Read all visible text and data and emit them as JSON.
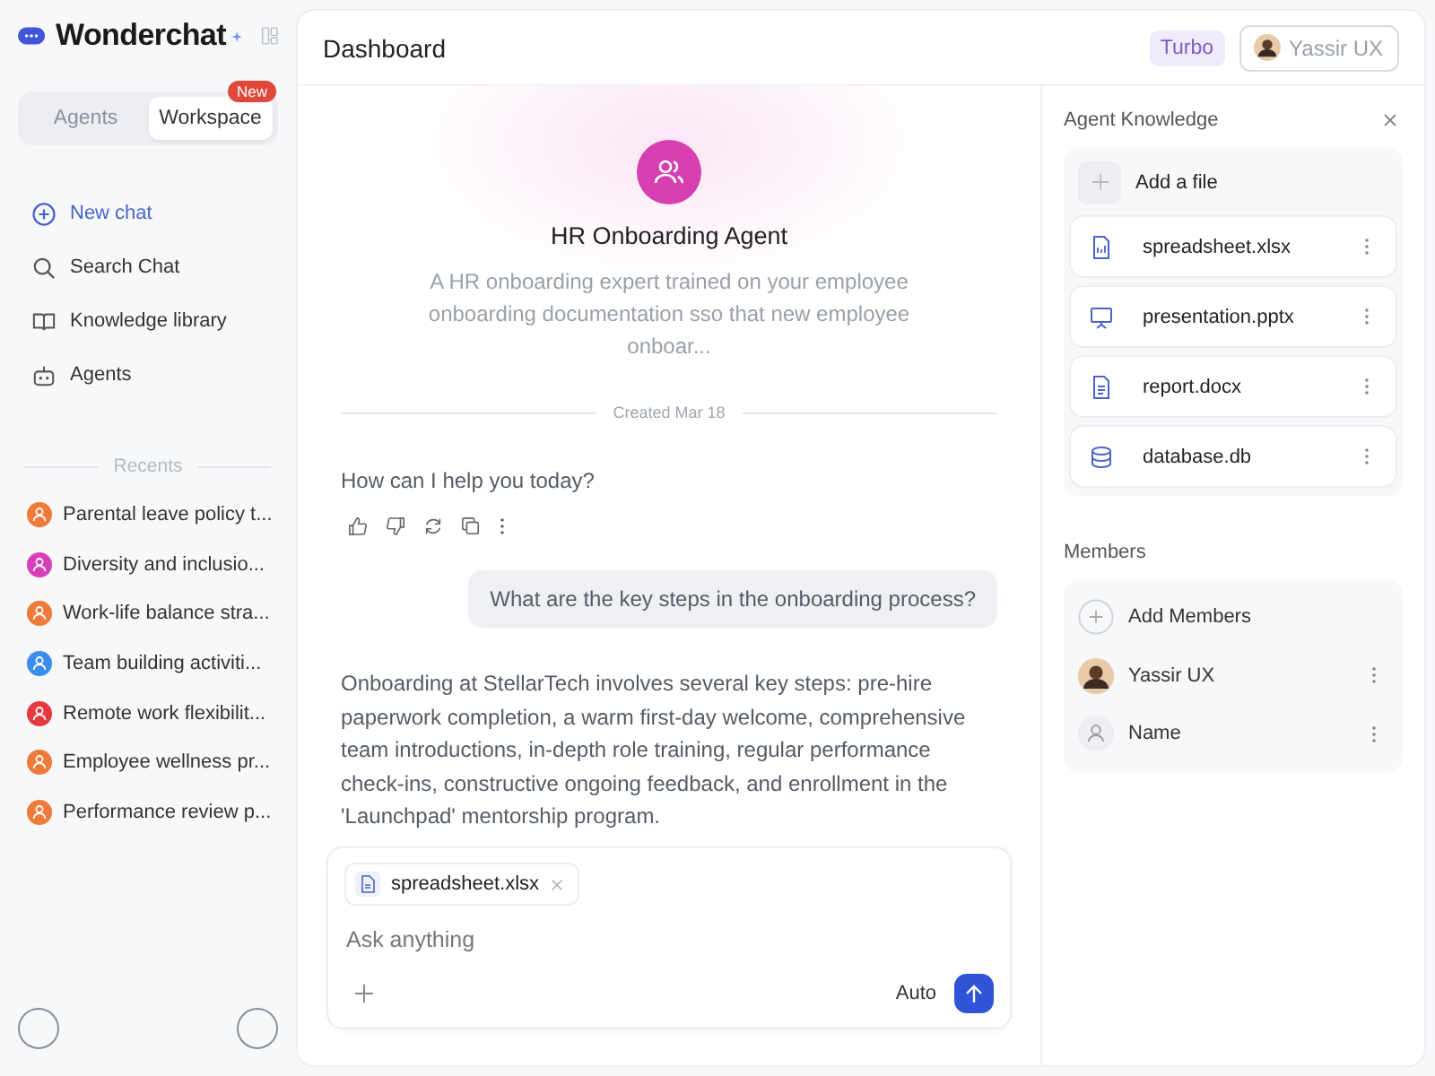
{
  "app": {
    "name": "Wonderchat"
  },
  "sidebar_tabs": [
    {
      "label": "Agents",
      "selected": false
    },
    {
      "label": "Workspace",
      "selected": true,
      "badge": "New"
    }
  ],
  "nav": [
    {
      "kind": "new",
      "label": "New chat"
    },
    {
      "kind": "search",
      "label": "Search Chat"
    },
    {
      "kind": "library",
      "label": "Knowledge library"
    },
    {
      "kind": "agents",
      "label": "Agents"
    }
  ],
  "recents_label": "Recents",
  "recents": [
    {
      "title": "Parental leave policy t...",
      "color": "#f07a3a"
    },
    {
      "title": "Diversity and inclusio...",
      "color": "#d63fb8"
    },
    {
      "title": "Work-life balance stra...",
      "color": "#f07a3a"
    },
    {
      "title": "Team building activiti...",
      "color": "#3b8ef0"
    },
    {
      "title": "Remote work flexibilit...",
      "color": "#e5393f"
    },
    {
      "title": "Employee wellness pr...",
      "color": "#f07a3a"
    },
    {
      "title": "Performance review p...",
      "color": "#f07a3a"
    }
  ],
  "header": {
    "title": "Dashboard",
    "plan": "Turbo",
    "user": "Yassir UX"
  },
  "agent": {
    "name": "HR Onboarding Agent",
    "description": "A HR onboarding expert trained on your employee onboarding documentation sso that new employee onboar...",
    "created": "Created Mar 18"
  },
  "messages": [
    {
      "kind": "assistant",
      "text": "How can I help you today?",
      "actions": true
    },
    {
      "kind": "user",
      "text": "What are the key steps in the onboarding process?",
      "actions": false
    },
    {
      "kind": "assistant",
      "text": "Onboarding at StellarTech involves several key steps: pre-hire paperwork completion, a warm first-day welcome, comprehensive team introductions, in-depth role training, regular performance check-ins, constructive ongoing feedback, and enrollment in the 'Launchpad' mentorship program.",
      "actions": false
    }
  ],
  "composer": {
    "attachments": [
      {
        "name": "spreadsheet.xlsx"
      }
    ],
    "placeholder": "Ask anything",
    "mode": "Auto"
  },
  "knowledge": {
    "title": "Agent Knowledge",
    "add_label": "Add a file",
    "files": [
      {
        "kind": "spreadsheet",
        "name": "spreadsheet.xlsx"
      },
      {
        "kind": "presentation",
        "name": "presentation.pptx"
      },
      {
        "kind": "document",
        "name": "report.docx"
      },
      {
        "kind": "database",
        "name": "database.db"
      }
    ]
  },
  "members": {
    "title": "Members",
    "items": [
      {
        "kind": "add",
        "name": "Add Members"
      },
      {
        "kind": "user",
        "name": "Yassir UX"
      },
      {
        "kind": "placeholder",
        "name": "Name"
      }
    ]
  }
}
